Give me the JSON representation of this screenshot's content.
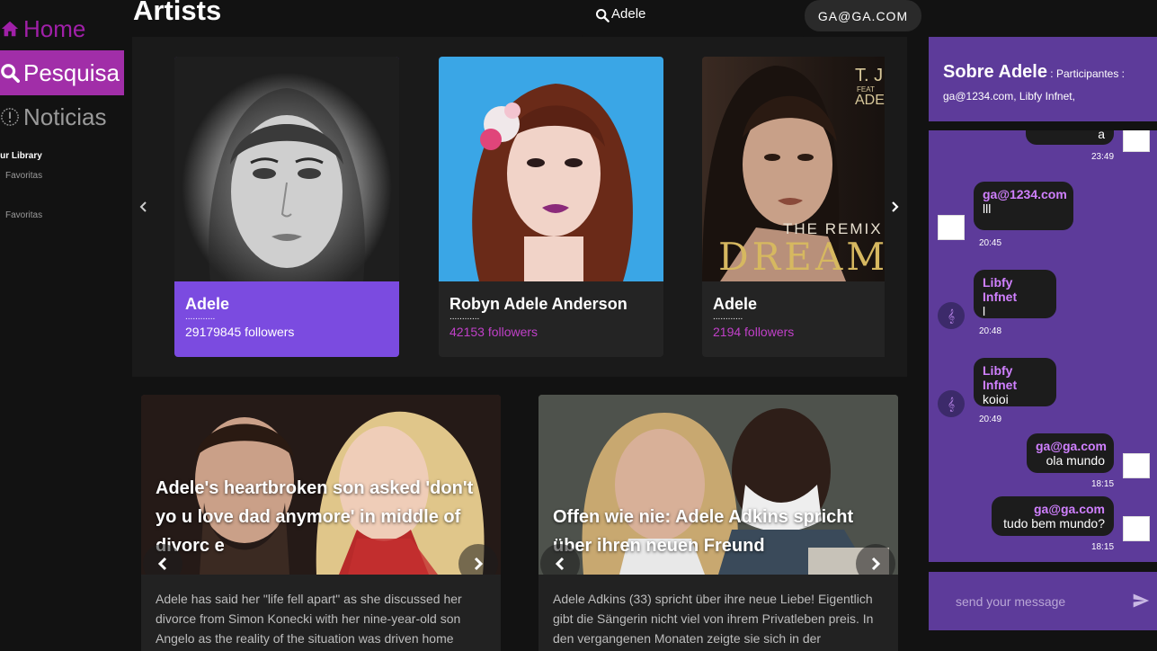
{
  "sidebar": {
    "home": "Home",
    "search": "Pesquisa",
    "news": "Noticias",
    "library_title": "our Library",
    "library_items": [
      "Favoritas",
      "Favoritas"
    ]
  },
  "header": {
    "title": "Artists",
    "search_value": "Adele",
    "user": "GA@GA.COM"
  },
  "artists": [
    {
      "name": "Adele",
      "dots": "............",
      "followers": "29179845 followers"
    },
    {
      "name": "Robyn Adele Anderson",
      "dots": "............",
      "followers": "42153 followers"
    },
    {
      "name": "Adele",
      "dots": "............",
      "followers": "2194 followers"
    }
  ],
  "album_text": {
    "top": "T. J",
    "feat": "FEAT",
    "ade": "ADE",
    "remix": "THE REMIX",
    "dream": "DREAM"
  },
  "news": [
    {
      "title": "Adele's heartbroken son asked 'don't yo u love dad anymore' in middle of divorc e",
      "body": "Adele has said her \"life fell apart\" as she discussed her divorce from Simon Konecki with her nine-year-old son Angelo as the reality of the situation was driven home"
    },
    {
      "title": "Offen wie nie: Adele Adkins spricht über ihren neuen Freund",
      "body": "Adele Adkins (33) spricht über ihre neue Liebe! Eigentlich gibt die Sängerin nicht viel von ihrem Privatleben preis. In den vergangenen Monaten zeigte sie sich in der"
    }
  ],
  "chat": {
    "title": "Sobre Adele",
    "sub": " : Participantes :",
    "participants": "ga@1234.com,  Libfy Infnet,",
    "messages": [
      {
        "who": "",
        "text": "a",
        "time": "23:49",
        "me": true
      },
      {
        "who": "ga@1234.com",
        "text": "lll",
        "time": "20:45",
        "me": false
      },
      {
        "who": "Libfy Infnet",
        "text": "l",
        "time": "20:48",
        "me": false
      },
      {
        "who": "Libfy Infnet",
        "text": "koioi",
        "time": "20:49",
        "me": false
      },
      {
        "who": "ga@ga.com",
        "text": "ola mundo",
        "time": "18:15",
        "me": true
      },
      {
        "who": "ga@ga.com",
        "text": "tudo bem mundo?",
        "time": "18:15",
        "me": true
      }
    ],
    "placeholder": "send your message"
  },
  "colors": {
    "accent": "#a12ea8",
    "card_active": "#7b4be0",
    "chat_bg": "#5d3b9a"
  }
}
